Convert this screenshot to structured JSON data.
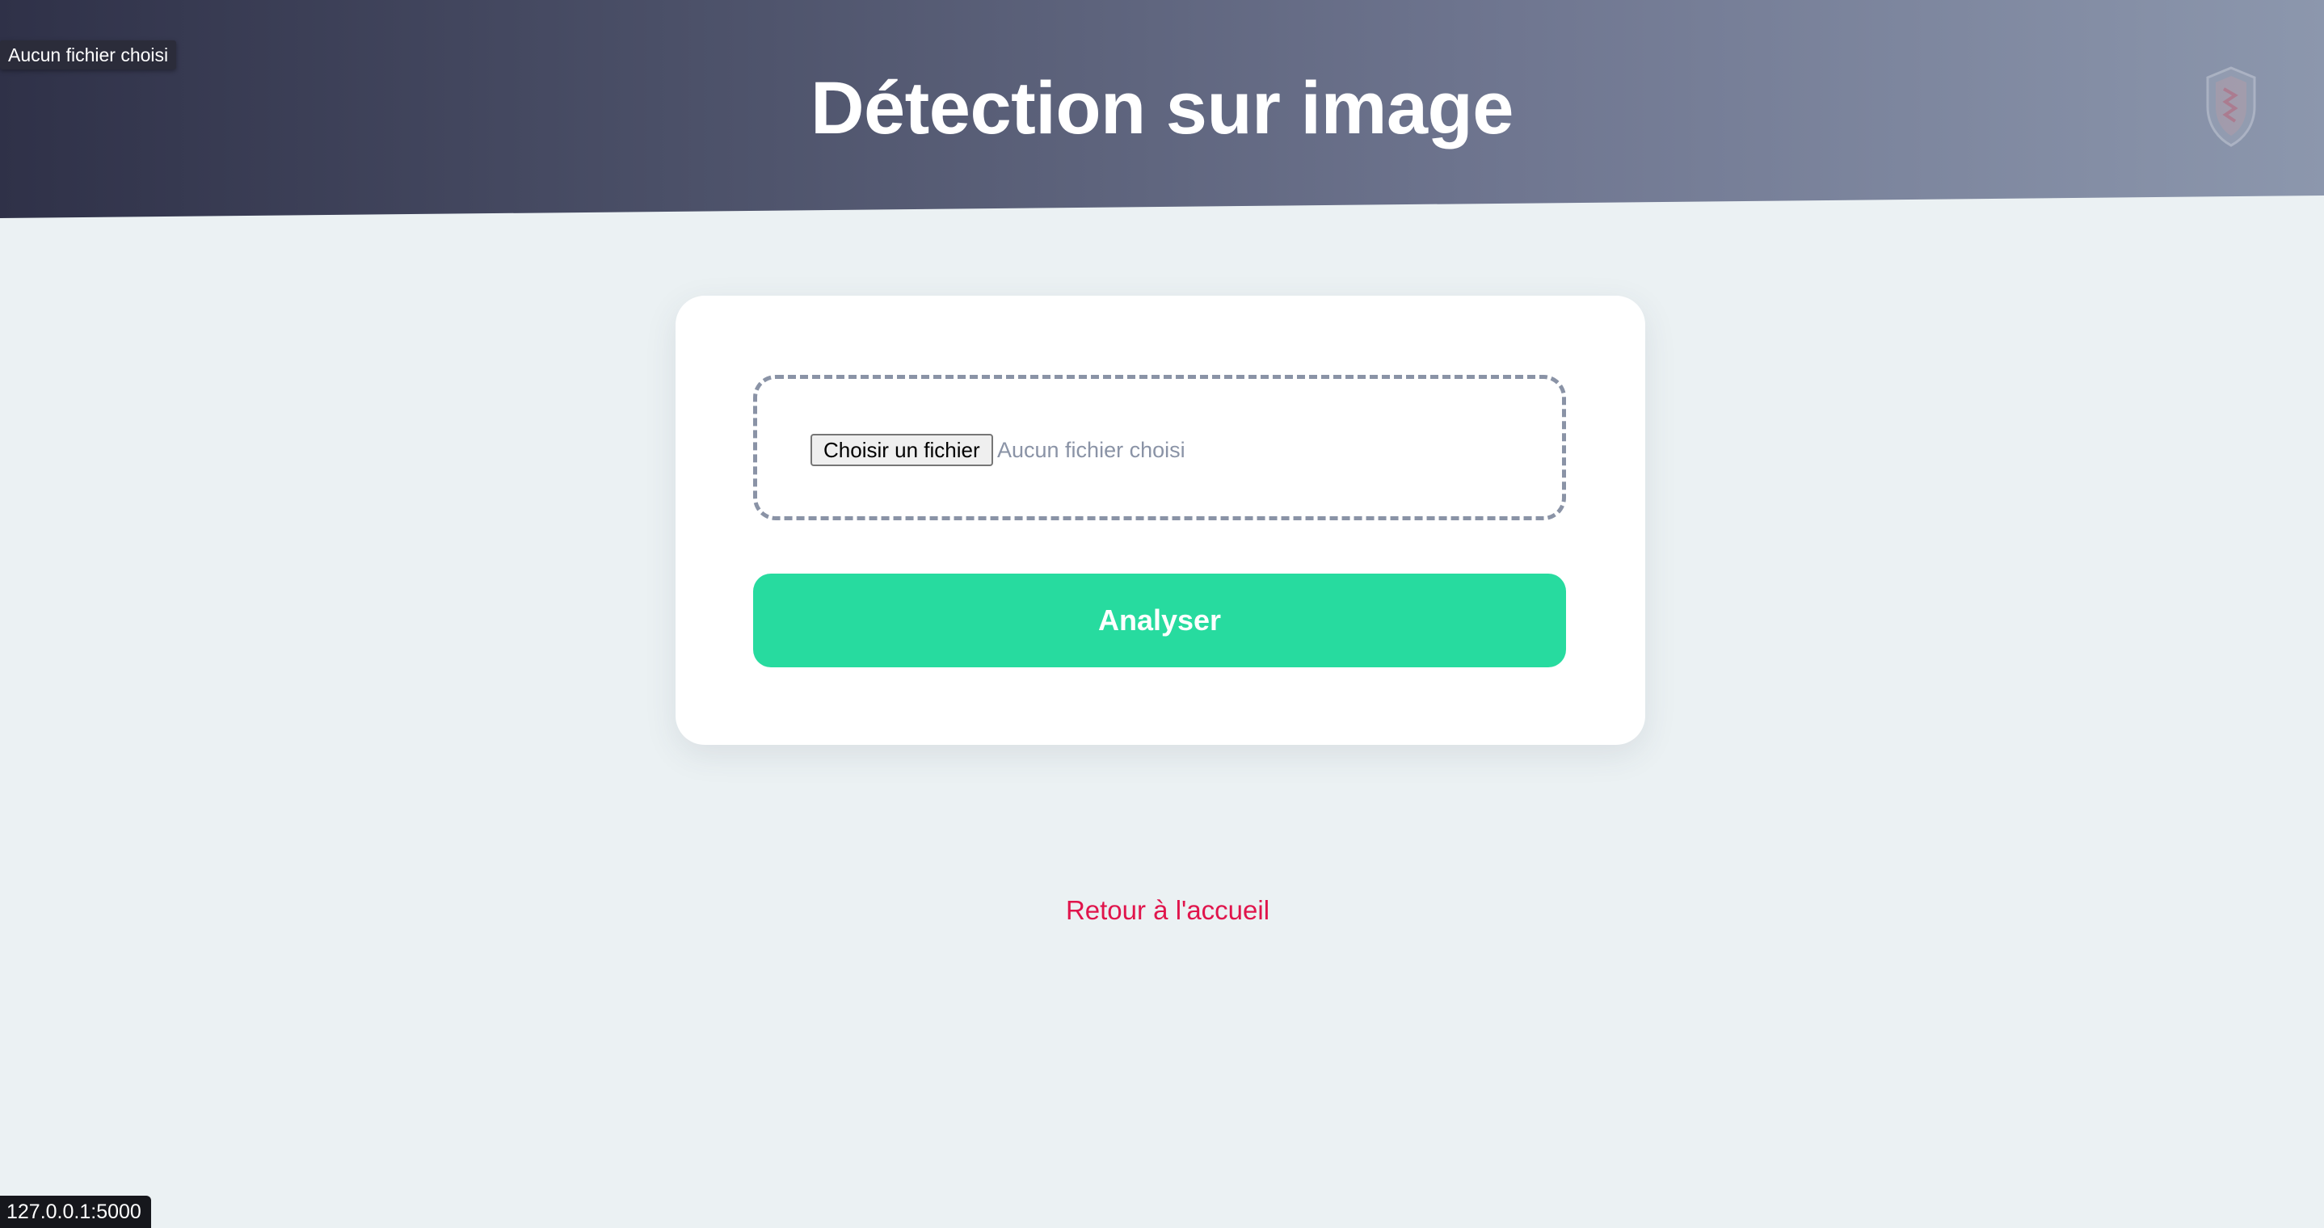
{
  "header": {
    "title": "Détection sur image",
    "logo_icon": "shield-icon"
  },
  "tooltip": {
    "text": "Aucun fichier choisi"
  },
  "upload": {
    "button_label": "Choisir un fichier",
    "status_text": "Aucun fichier choisi"
  },
  "actions": {
    "analyze_label": "Analyser"
  },
  "footer": {
    "home_link": "Retour à l'accueil"
  },
  "browser": {
    "status_url": "127.0.0.1:5000"
  },
  "colors": {
    "header_gradient_start": "#2f3148",
    "header_gradient_end": "#8c97ad",
    "page_background": "#ebf1f3",
    "analyze_button": "#27db9f",
    "link": "#e0154c",
    "dropzone_border": "#8a93a6"
  }
}
